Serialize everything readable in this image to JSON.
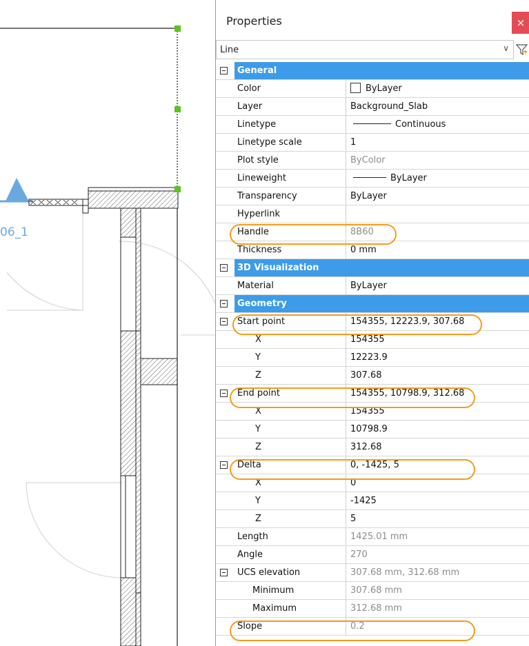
{
  "canvas": {
    "room_label": "06_1",
    "colors": {
      "lines": "#222222",
      "grip": "#5cc21d",
      "room_label": "#6aa8e0",
      "symbol": "#6aa8e0",
      "arc": "#d0d0d0"
    }
  },
  "panel": {
    "title": "Properties",
    "close_symbol": "×",
    "close_color": "#e54b55",
    "selected_object": "Line",
    "chevron": "∨",
    "filter_icon": "filter-lightning-icon",
    "accent": "#3d9be9",
    "highlight_color": "#f49a1a"
  },
  "sections": {
    "general": "General",
    "visualization": "3D Visualization",
    "geometry": "Geometry"
  },
  "general": {
    "color": {
      "label": "Color",
      "value": "ByLayer"
    },
    "layer": {
      "label": "Layer",
      "value": "Background_Slab"
    },
    "linetype": {
      "label": "Linetype",
      "value": "Continuous"
    },
    "linetype_scale": {
      "label": "Linetype scale",
      "value": "1"
    },
    "plot_style": {
      "label": "Plot style",
      "value": "ByColor"
    },
    "lineweight": {
      "label": "Lineweight",
      "value": "ByLayer"
    },
    "transparency": {
      "label": "Transparency",
      "value": "ByLayer"
    },
    "hyperlink": {
      "label": "Hyperlink",
      "value": ""
    },
    "handle": {
      "label": "Handle",
      "value": "8B60"
    },
    "thickness": {
      "label": "Thickness",
      "value": "0 mm"
    }
  },
  "visualization": {
    "material": {
      "label": "Material",
      "value": "ByLayer"
    }
  },
  "geometry": {
    "start_point": {
      "label": "Start point",
      "value": "154355, 12223.9, 307.68",
      "x": "154355",
      "y": "12223.9",
      "z": "307.68"
    },
    "end_point": {
      "label": "End point",
      "value": "154355, 10798.9, 312.68",
      "x": "154355",
      "y": "10798.9",
      "z": "312.68"
    },
    "delta": {
      "label": "Delta",
      "value": "0, -1425, 5",
      "x": "0",
      "y": "-1425",
      "z": "5"
    },
    "axis_x": "X",
    "axis_y": "Y",
    "axis_z": "Z",
    "length": {
      "label": "Length",
      "value": "1425.01 mm"
    },
    "angle": {
      "label": "Angle",
      "value": "270"
    },
    "ucs_elevation": {
      "label": "UCS elevation",
      "value": "307.68 mm, 312.68 mm"
    },
    "minimum": {
      "label": "Minimum",
      "value": "307.68 mm"
    },
    "maximum": {
      "label": "Maximum",
      "value": "312.68 mm"
    },
    "slope": {
      "label": "Slope",
      "value": "0.2"
    }
  }
}
